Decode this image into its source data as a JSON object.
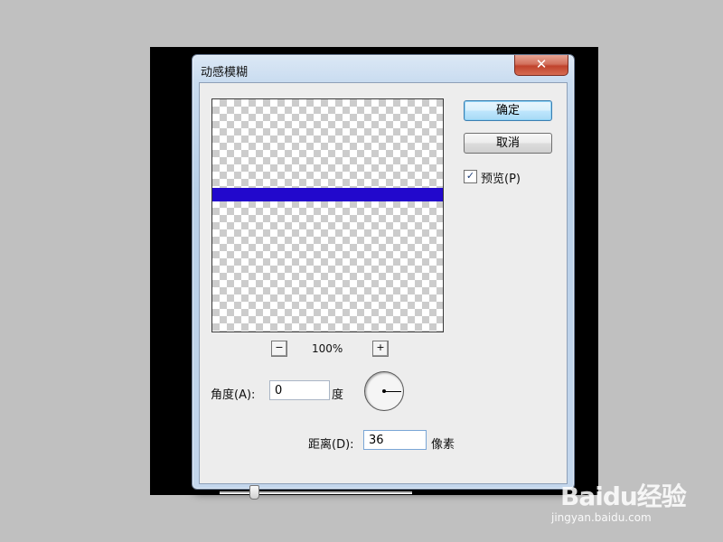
{
  "dialog": {
    "title": "动感模糊",
    "close_label": "✕"
  },
  "buttons": {
    "ok_label": "确定",
    "cancel_label": "取消"
  },
  "preview_option": {
    "checked": true,
    "label": "预览(P)"
  },
  "zoom": {
    "minus_label": "−",
    "level": "100%",
    "plus_label": "+"
  },
  "angle": {
    "label": "角度(A):",
    "value": "0",
    "unit": "度"
  },
  "distance": {
    "label": "距离(D):",
    "value": "36",
    "unit": "像素",
    "slider_fraction": 0.18
  },
  "preview_content": {
    "bar_color": "#2208cc"
  },
  "watermark": {
    "brand": "Baidu经验",
    "url": "jingyan.baidu.com"
  }
}
